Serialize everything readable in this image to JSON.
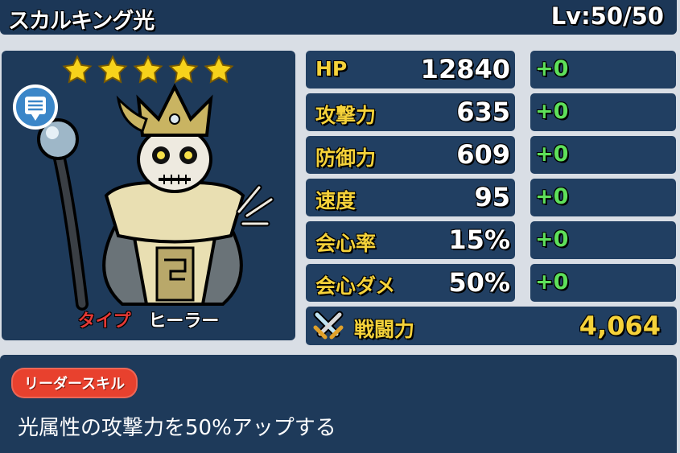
{
  "header": {
    "name": "スカルキング光",
    "level": "Lv:50/50"
  },
  "character": {
    "stars": 5,
    "type_label": "タイプ",
    "type_value": "ヒーラー"
  },
  "stats": [
    {
      "label": "HP",
      "value": "12840",
      "bonus": "+0"
    },
    {
      "label": "攻撃力",
      "value": "635",
      "bonus": "+0"
    },
    {
      "label": "防御力",
      "value": "609",
      "bonus": "+0"
    },
    {
      "label": "速度",
      "value": "95",
      "bonus": "+0"
    },
    {
      "label": "会心率",
      "value": "15%",
      "bonus": "+0"
    },
    {
      "label": "会心ダメ",
      "value": "50%",
      "bonus": "+0"
    }
  ],
  "power": {
    "label": "戦闘力",
    "value": "4,064"
  },
  "skill": {
    "badge": "リーダースキル",
    "description": "光属性の攻撃力を50%アップする"
  },
  "colors": {
    "panel": "#1f3b5c",
    "stat_label": "#f5d23a",
    "bonus": "#5ee05a",
    "type_label": "#e53935",
    "skill_badge": "#e8412e"
  },
  "icons": [
    "star-icon",
    "chat-bubble-icon",
    "crossed-swords-icon"
  ]
}
